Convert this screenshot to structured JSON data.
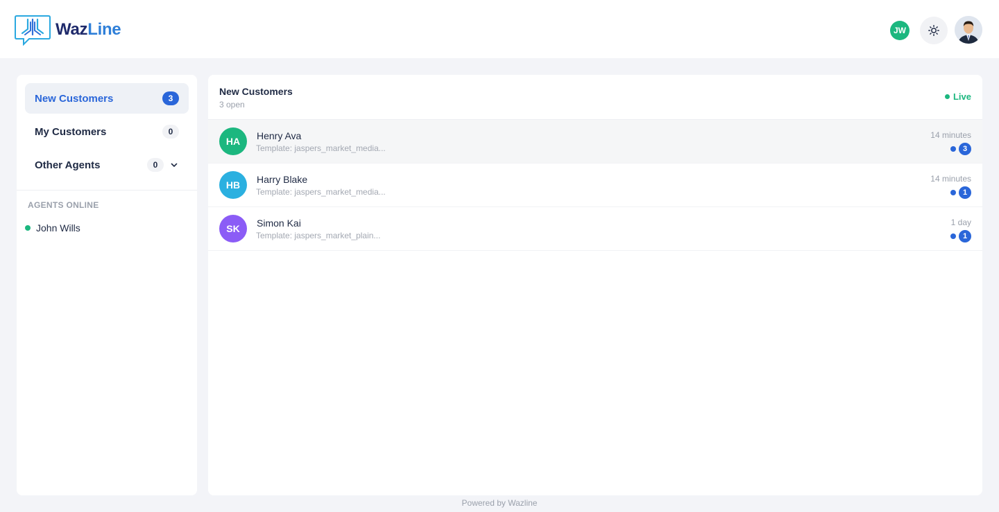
{
  "brand": {
    "name_part1": "Waz",
    "name_part2": "Line"
  },
  "topbar": {
    "user_initials": "JW"
  },
  "sidebar": {
    "items": [
      {
        "label": "New Customers",
        "count": "3",
        "active": true
      },
      {
        "label": "My Customers",
        "count": "0",
        "active": false
      },
      {
        "label": "Other Agents",
        "count": "0",
        "active": false
      }
    ],
    "agents_title": "AGENTS ONLINE",
    "agents": [
      {
        "name": "John Wills",
        "status_color": "#1cb77f"
      }
    ]
  },
  "main": {
    "title": "New Customers",
    "subtitle": "3 open",
    "live_label": "Live",
    "rows": [
      {
        "initials": "HA",
        "name": "Henry Ava",
        "preview": "Template: jaspers_market_media...",
        "time": "14 minutes",
        "count": "3",
        "color": "#1cb77f"
      },
      {
        "initials": "HB",
        "name": "Harry Blake",
        "preview": "Template: jaspers_market_media...",
        "time": "14 minutes",
        "count": "1",
        "color": "#2bb0e0"
      },
      {
        "initials": "SK",
        "name": "Simon Kai",
        "preview": "Template: jaspers_market_plain...",
        "time": "1 day",
        "count": "1",
        "color": "#8b5cf6"
      }
    ]
  },
  "footer": {
    "text": "Powered by Wazline"
  },
  "colors": {
    "accent": "#2a66d9",
    "online": "#1cb77f"
  }
}
